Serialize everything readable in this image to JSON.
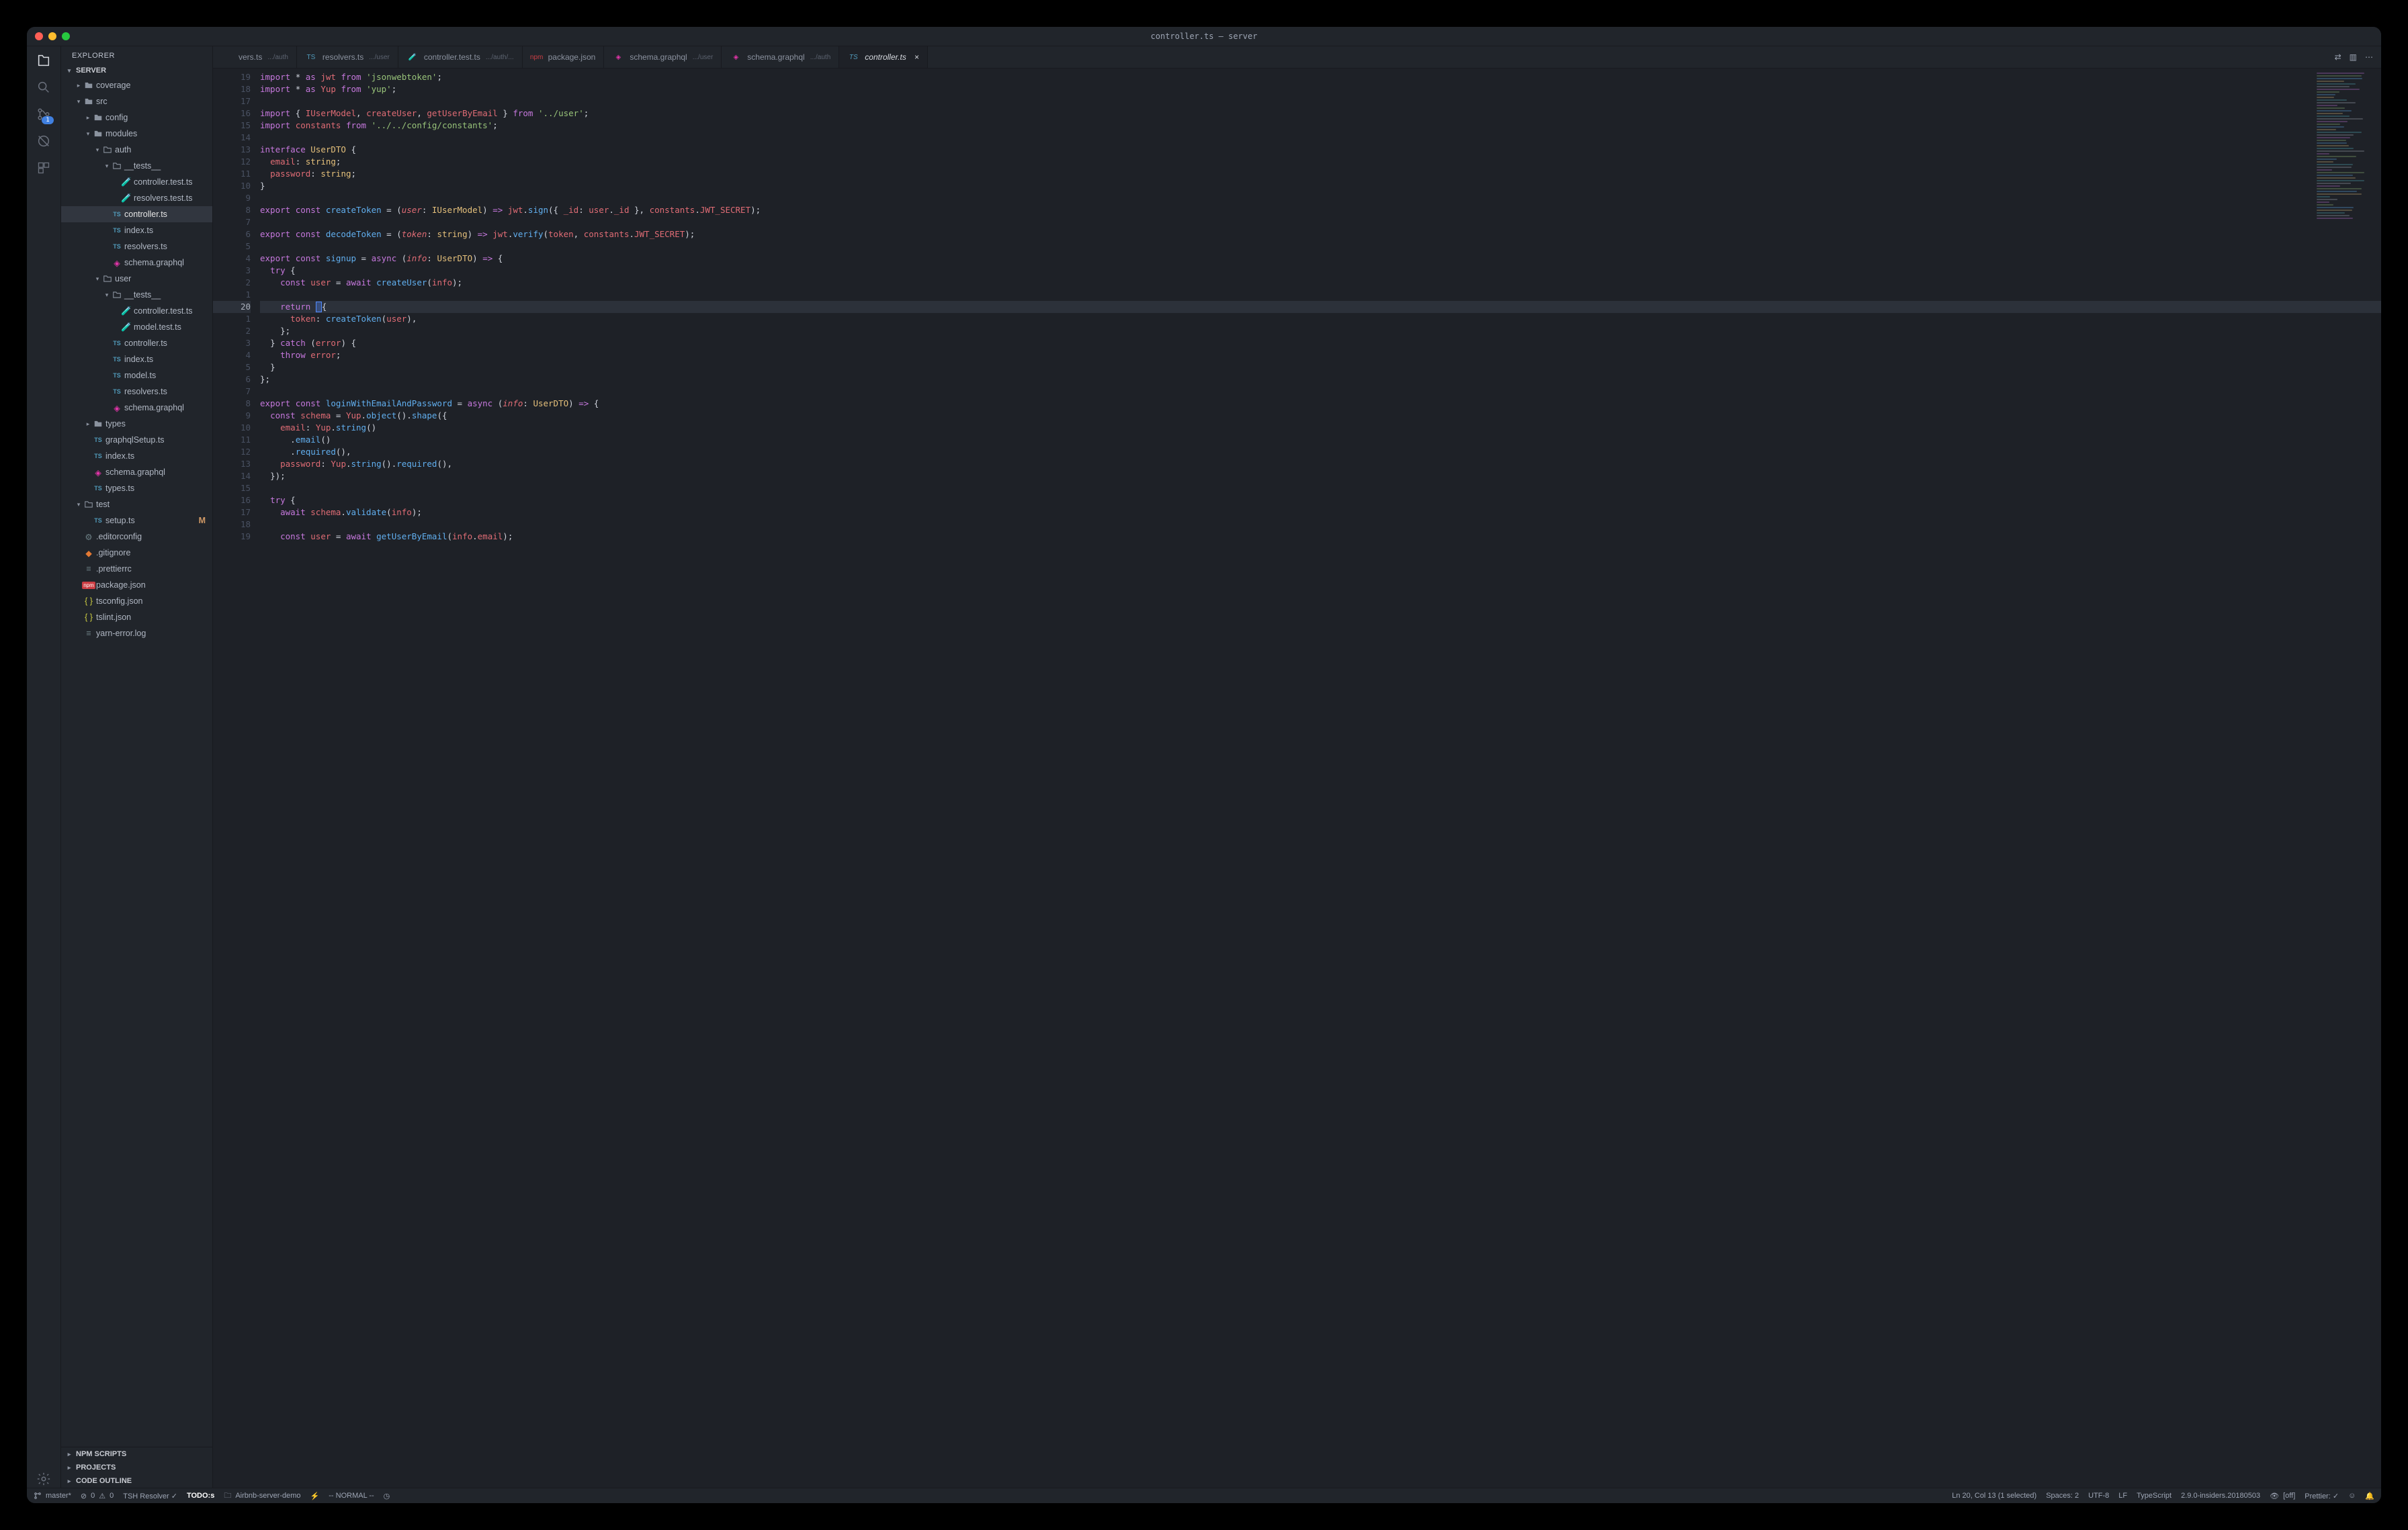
{
  "title": "controller.ts — server",
  "explorer": {
    "title": "EXPLORER"
  },
  "project": {
    "name": "SERVER"
  },
  "scm_badge": "1",
  "tree": [
    {
      "d": 1,
      "ic": "folder",
      "ico": "c-folder",
      "c": "▸",
      "label": "coverage"
    },
    {
      "d": 1,
      "ic": "folder",
      "ico": "c-folder",
      "c": "▾",
      "label": "src"
    },
    {
      "d": 2,
      "ic": "folder",
      "ico": "c-folder",
      "c": "▸",
      "label": "config"
    },
    {
      "d": 2,
      "ic": "folder",
      "ico": "c-folder",
      "c": "▾",
      "label": "modules"
    },
    {
      "d": 3,
      "ic": "folder-o",
      "ico": "c-folder",
      "c": "▾",
      "label": "auth"
    },
    {
      "d": 4,
      "ic": "folder-o",
      "ico": "c-folder",
      "c": "▾",
      "label": "__tests__"
    },
    {
      "d": 5,
      "ic": "ts-test",
      "ico": "c-blue",
      "label": "controller.test.ts"
    },
    {
      "d": 5,
      "ic": "ts-test",
      "ico": "c-blue",
      "label": "resolvers.test.ts"
    },
    {
      "d": 4,
      "ic": "ts",
      "ico": "c-blue",
      "label": "controller.ts",
      "sel": true
    },
    {
      "d": 4,
      "ic": "ts",
      "ico": "c-blue",
      "label": "index.ts"
    },
    {
      "d": 4,
      "ic": "ts",
      "ico": "c-blue",
      "label": "resolvers.ts"
    },
    {
      "d": 4,
      "ic": "gql",
      "ico": "c-pink",
      "label": "schema.graphql"
    },
    {
      "d": 3,
      "ic": "folder-o",
      "ico": "c-folder",
      "c": "▾",
      "label": "user"
    },
    {
      "d": 4,
      "ic": "folder-o",
      "ico": "c-folder",
      "c": "▾",
      "label": "__tests__"
    },
    {
      "d": 5,
      "ic": "ts-test",
      "ico": "c-blue",
      "label": "controller.test.ts"
    },
    {
      "d": 5,
      "ic": "ts-test",
      "ico": "c-blue",
      "label": "model.test.ts"
    },
    {
      "d": 4,
      "ic": "ts",
      "ico": "c-blue",
      "label": "controller.ts"
    },
    {
      "d": 4,
      "ic": "ts",
      "ico": "c-blue",
      "label": "index.ts"
    },
    {
      "d": 4,
      "ic": "ts",
      "ico": "c-blue",
      "label": "model.ts"
    },
    {
      "d": 4,
      "ic": "ts",
      "ico": "c-blue",
      "label": "resolvers.ts"
    },
    {
      "d": 4,
      "ic": "gql",
      "ico": "c-pink",
      "label": "schema.graphql"
    },
    {
      "d": 2,
      "ic": "folder",
      "ico": "c-folder",
      "c": "▸",
      "label": "types"
    },
    {
      "d": 2,
      "ic": "ts",
      "ico": "c-blue",
      "label": "graphqlSetup.ts"
    },
    {
      "d": 2,
      "ic": "ts",
      "ico": "c-blue",
      "label": "index.ts"
    },
    {
      "d": 2,
      "ic": "gql",
      "ico": "c-pink",
      "label": "schema.graphql"
    },
    {
      "d": 2,
      "ic": "ts",
      "ico": "c-blue",
      "label": "types.ts"
    },
    {
      "d": 1,
      "ic": "folder-o",
      "ico": "c-folder",
      "c": "▾",
      "label": "test"
    },
    {
      "d": 2,
      "ic": "ts",
      "ico": "c-blue",
      "label": "setup.ts",
      "mod": "M"
    },
    {
      "d": 1,
      "ic": "cog",
      "ico": "c-grey",
      "label": ".editorconfig"
    },
    {
      "d": 1,
      "ic": "git",
      "ico": "c-orange",
      "label": ".gitignore"
    },
    {
      "d": 1,
      "ic": "txt",
      "ico": "c-grey",
      "label": ".prettierrc"
    },
    {
      "d": 1,
      "ic": "npm",
      "ico": "c-red",
      "label": "package.json"
    },
    {
      "d": 1,
      "ic": "json",
      "ico": "c-yellow",
      "label": "tsconfig.json"
    },
    {
      "d": 1,
      "ic": "json",
      "ico": "c-yellow",
      "label": "tslint.json"
    },
    {
      "d": 1,
      "ic": "txt",
      "ico": "c-grey",
      "label": "yarn-error.log"
    }
  ],
  "sections": [
    {
      "label": "NPM SCRIPTS"
    },
    {
      "label": "PROJECTS"
    },
    {
      "label": "CODE OUTLINE"
    }
  ],
  "tabs": [
    {
      "ic": "",
      "label": "vers.ts",
      "sub": ".../auth"
    },
    {
      "ic": "TS",
      "ico": "c-blue",
      "label": "resolvers.ts",
      "sub": ".../user"
    },
    {
      "ic": "🧪",
      "ico": "c-blue",
      "label": "controller.test.ts",
      "sub": ".../auth/..."
    },
    {
      "ic": "npm",
      "ico": "c-red",
      "label": "package.json",
      "sub": ""
    },
    {
      "ic": "◈",
      "ico": "c-pink",
      "label": "schema.graphql",
      "sub": ".../user"
    },
    {
      "ic": "◈",
      "ico": "c-pink",
      "label": "schema.graphql",
      "sub": ".../auth"
    },
    {
      "ic": "TS",
      "ico": "c-blue",
      "label": "controller.ts",
      "sub": "",
      "active": true,
      "close": true
    }
  ],
  "tab_actions": {
    "compare": "⇄",
    "split": "▥",
    "more": "⋯"
  },
  "gutter": [
    "19",
    "18",
    "17",
    "16",
    "15",
    "14",
    "13",
    "12",
    "11",
    "10",
    "9",
    "8",
    "7",
    "6",
    "5",
    "4",
    "3",
    "2",
    "1",
    "20",
    "1",
    "2",
    "3",
    "4",
    "5",
    "6",
    "7",
    "8",
    "9",
    "10",
    "11",
    "12",
    "13",
    "14",
    "15",
    "16",
    "17",
    "18",
    "19"
  ],
  "code": [
    [
      [
        "k",
        "import "
      ],
      [
        "p",
        "* "
      ],
      [
        "k",
        "as "
      ],
      [
        "v",
        "jwt "
      ],
      [
        "k",
        "from "
      ],
      [
        "s",
        "'jsonwebtoken'"
      ],
      [
        "p",
        ";"
      ]
    ],
    [
      [
        "k",
        "import "
      ],
      [
        "p",
        "* "
      ],
      [
        "k",
        "as "
      ],
      [
        "v",
        "Yup "
      ],
      [
        "k",
        "from "
      ],
      [
        "s",
        "'yup'"
      ],
      [
        "p",
        ";"
      ]
    ],
    [],
    [
      [
        "k",
        "import "
      ],
      [
        "p",
        "{ "
      ],
      [
        "v",
        "IUserModel"
      ],
      [
        "p",
        ", "
      ],
      [
        "v",
        "createUser"
      ],
      [
        "p",
        ", "
      ],
      [
        "v",
        "getUserByEmail "
      ],
      [
        "p",
        "} "
      ],
      [
        "k",
        "from "
      ],
      [
        "s",
        "'../user'"
      ],
      [
        "p",
        ";"
      ]
    ],
    [
      [
        "k",
        "import "
      ],
      [
        "v",
        "constants "
      ],
      [
        "k",
        "from "
      ],
      [
        "s",
        "'../../config/constants'"
      ],
      [
        "p",
        ";"
      ]
    ],
    [],
    [
      [
        "k",
        "interface "
      ],
      [
        "t",
        "UserDTO "
      ],
      [
        "p",
        "{"
      ]
    ],
    [
      [
        "c",
        "  "
      ],
      [
        "v",
        "email"
      ],
      [
        "p",
        ": "
      ],
      [
        "t",
        "string"
      ],
      [
        "p",
        ";"
      ]
    ],
    [
      [
        "c",
        "  "
      ],
      [
        "v",
        "password"
      ],
      [
        "p",
        ": "
      ],
      [
        "t",
        "string"
      ],
      [
        "p",
        ";"
      ]
    ],
    [
      [
        "p",
        "}"
      ]
    ],
    [],
    [
      [
        "k",
        "export "
      ],
      [
        "k",
        "const "
      ],
      [
        "f",
        "createToken "
      ],
      [
        "p",
        "= ("
      ],
      [
        "v i",
        "user"
      ],
      [
        "p",
        ": "
      ],
      [
        "t",
        "IUserModel"
      ],
      [
        "p",
        ") "
      ],
      [
        "k",
        "=> "
      ],
      [
        "v",
        "jwt"
      ],
      [
        "p",
        "."
      ],
      [
        "f",
        "sign"
      ],
      [
        "p",
        "({ "
      ],
      [
        "v",
        "_id"
      ],
      [
        "p",
        ": "
      ],
      [
        "v",
        "user"
      ],
      [
        "p",
        "."
      ],
      [
        "v",
        "_id "
      ],
      [
        "p",
        "}, "
      ],
      [
        "v",
        "constants"
      ],
      [
        "p",
        "."
      ],
      [
        "v",
        "JWT_SECRET"
      ],
      [
        "p",
        ");"
      ]
    ],
    [],
    [
      [
        "k",
        "export "
      ],
      [
        "k",
        "const "
      ],
      [
        "f",
        "decodeToken "
      ],
      [
        "p",
        "= ("
      ],
      [
        "v i",
        "token"
      ],
      [
        "p",
        ": "
      ],
      [
        "t",
        "string"
      ],
      [
        "p",
        ") "
      ],
      [
        "k",
        "=> "
      ],
      [
        "v",
        "jwt"
      ],
      [
        "p",
        "."
      ],
      [
        "f",
        "verify"
      ],
      [
        "p",
        "("
      ],
      [
        "v",
        "token"
      ],
      [
        "p",
        ", "
      ],
      [
        "v",
        "constants"
      ],
      [
        "p",
        "."
      ],
      [
        "v",
        "JWT_SECRET"
      ],
      [
        "p",
        ");"
      ]
    ],
    [],
    [
      [
        "k",
        "export "
      ],
      [
        "k",
        "const "
      ],
      [
        "f",
        "signup "
      ],
      [
        "p",
        "= "
      ],
      [
        "k",
        "async "
      ],
      [
        "p",
        "("
      ],
      [
        "v i",
        "info"
      ],
      [
        "p",
        ": "
      ],
      [
        "t",
        "UserDTO"
      ],
      [
        "p",
        ") "
      ],
      [
        "k",
        "=> "
      ],
      [
        "p",
        "{"
      ]
    ],
    [
      [
        "c",
        "  "
      ],
      [
        "k",
        "try "
      ],
      [
        "p",
        "{"
      ]
    ],
    [
      [
        "c",
        "    "
      ],
      [
        "k",
        "const "
      ],
      [
        "v",
        "user "
      ],
      [
        "p",
        "= "
      ],
      [
        "k",
        "await "
      ],
      [
        "f",
        "createUser"
      ],
      [
        "p",
        "("
      ],
      [
        "v",
        "info"
      ],
      [
        "p",
        ");"
      ]
    ],
    [],
    [
      [
        "c",
        "    "
      ],
      [
        "k",
        "return "
      ],
      [
        "caret",
        "{"
      ]
    ],
    [
      [
        "c",
        "      "
      ],
      [
        "v",
        "token"
      ],
      [
        "p",
        ": "
      ],
      [
        "f",
        "createToken"
      ],
      [
        "p",
        "("
      ],
      [
        "v",
        "user"
      ],
      [
        "p",
        "),"
      ]
    ],
    [
      [
        "c",
        "    "
      ],
      [
        "p",
        "};"
      ]
    ],
    [
      [
        "c",
        "  "
      ],
      [
        "p",
        "} "
      ],
      [
        "k",
        "catch "
      ],
      [
        "p",
        "("
      ],
      [
        "v",
        "error"
      ],
      [
        "p",
        ") {"
      ]
    ],
    [
      [
        "c",
        "    "
      ],
      [
        "k",
        "throw "
      ],
      [
        "v",
        "error"
      ],
      [
        "p",
        ";"
      ]
    ],
    [
      [
        "c",
        "  "
      ],
      [
        "p",
        "}"
      ]
    ],
    [
      [
        "p",
        "};"
      ]
    ],
    [],
    [
      [
        "k",
        "export "
      ],
      [
        "k",
        "const "
      ],
      [
        "f",
        "loginWithEmailAndPassword "
      ],
      [
        "p",
        "= "
      ],
      [
        "k",
        "async "
      ],
      [
        "p",
        "("
      ],
      [
        "v i",
        "info"
      ],
      [
        "p",
        ": "
      ],
      [
        "t",
        "UserDTO"
      ],
      [
        "p",
        ") "
      ],
      [
        "k",
        "=> "
      ],
      [
        "p",
        "{"
      ]
    ],
    [
      [
        "c",
        "  "
      ],
      [
        "k",
        "const "
      ],
      [
        "v",
        "schema "
      ],
      [
        "p",
        "= "
      ],
      [
        "v",
        "Yup"
      ],
      [
        "p",
        "."
      ],
      [
        "f",
        "object"
      ],
      [
        "p",
        "()."
      ],
      [
        "f",
        "shape"
      ],
      [
        "p",
        "({"
      ]
    ],
    [
      [
        "c",
        "    "
      ],
      [
        "v",
        "email"
      ],
      [
        "p",
        ": "
      ],
      [
        "v",
        "Yup"
      ],
      [
        "p",
        "."
      ],
      [
        "f",
        "string"
      ],
      [
        "p",
        "()"
      ]
    ],
    [
      [
        "c",
        "      "
      ],
      [
        "p",
        "."
      ],
      [
        "f",
        "email"
      ],
      [
        "p",
        "()"
      ]
    ],
    [
      [
        "c",
        "      "
      ],
      [
        "p",
        "."
      ],
      [
        "f",
        "required"
      ],
      [
        "p",
        "(),"
      ]
    ],
    [
      [
        "c",
        "    "
      ],
      [
        "v",
        "password"
      ],
      [
        "p",
        ": "
      ],
      [
        "v",
        "Yup"
      ],
      [
        "p",
        "."
      ],
      [
        "f",
        "string"
      ],
      [
        "p",
        "()."
      ],
      [
        "f",
        "required"
      ],
      [
        "p",
        "(),"
      ]
    ],
    [
      [
        "c",
        "  "
      ],
      [
        "p",
        "});"
      ]
    ],
    [],
    [
      [
        "c",
        "  "
      ],
      [
        "k",
        "try "
      ],
      [
        "p",
        "{"
      ]
    ],
    [
      [
        "c",
        "    "
      ],
      [
        "k",
        "await "
      ],
      [
        "v",
        "schema"
      ],
      [
        "p",
        "."
      ],
      [
        "f",
        "validate"
      ],
      [
        "p",
        "("
      ],
      [
        "v",
        "info"
      ],
      [
        "p",
        ");"
      ]
    ],
    [],
    [
      [
        "c",
        "    "
      ],
      [
        "k",
        "const "
      ],
      [
        "v",
        "user "
      ],
      [
        "p",
        "= "
      ],
      [
        "k",
        "await "
      ],
      [
        "f",
        "getUserByEmail"
      ],
      [
        "p",
        "("
      ],
      [
        "v",
        "info"
      ],
      [
        "p",
        "."
      ],
      [
        "v",
        "email"
      ],
      [
        "p",
        ");"
      ]
    ]
  ],
  "status": {
    "branch": "master*",
    "errors": "0",
    "warnings": "0",
    "resolver": "TSH Resolver ✓",
    "todos": "TODO:s",
    "repo": "Airbnb-server-demo",
    "vim": "-- NORMAL --",
    "pos": "Ln 20, Col 13 (1 selected)",
    "spaces": "Spaces: 2",
    "enc": "UTF-8",
    "eol": "LF",
    "lang": "TypeScript",
    "tsver": "2.9.0-insiders.20180503",
    "eye": "[off]",
    "prettier": "Prettier: ✓"
  }
}
